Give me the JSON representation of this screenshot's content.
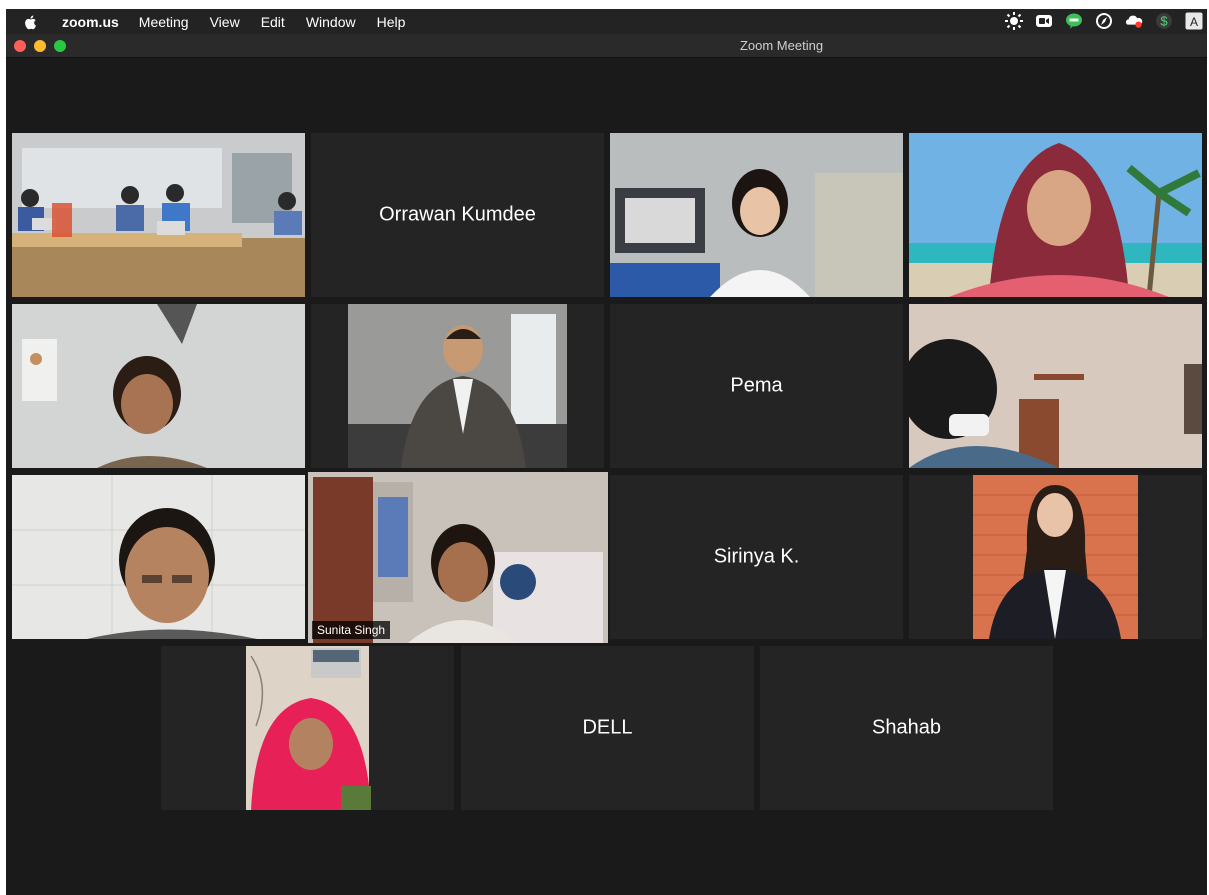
{
  "menubar": {
    "app_name": "zoom.us",
    "menus": [
      "Meeting",
      "View",
      "Edit",
      "Window",
      "Help"
    ],
    "tray_icons": [
      "brightness-icon",
      "zoom-video-icon",
      "line-chat-icon",
      "compass-icon",
      "creative-cloud-icon",
      "dollar-icon",
      "input-source-icon"
    ],
    "input_source_label": "A"
  },
  "window": {
    "title": "Zoom Meeting"
  },
  "participants": [
    {
      "name": "Orrawan Kumdee"
    },
    {
      "name": "Pema"
    },
    {
      "name": "Sunita Singh"
    },
    {
      "name": "Sirinya K."
    },
    {
      "name": "DELL"
    },
    {
      "name": "Shahab"
    }
  ],
  "colors": {
    "active_speaker_border": "#c2e06a",
    "tile_background": "#242424",
    "gallery_background": "#1a1a1a"
  }
}
